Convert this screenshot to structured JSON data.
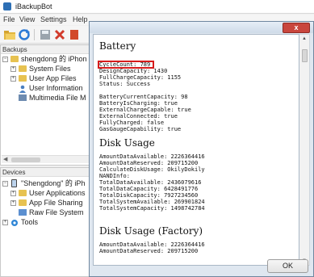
{
  "app": {
    "title": "iBackupBot",
    "menu": [
      "File",
      "View",
      "Settings",
      "Help"
    ],
    "backups_pane": {
      "header": "Backups",
      "items": [
        {
          "label": "shengdong 的 iPhon",
          "expander": "−",
          "icon": "folder"
        },
        {
          "label": "System Files",
          "expander": "+",
          "icon": "folder"
        },
        {
          "label": "User App Files",
          "expander": "+",
          "icon": "folder"
        },
        {
          "label": "User Information",
          "expander": "",
          "icon": "user"
        },
        {
          "label": "Multimedia File M",
          "expander": "",
          "icon": "media"
        }
      ]
    },
    "devices_pane": {
      "header": "Devices",
      "items": [
        {
          "label": "\"Shengdong\" 的 iPh",
          "expander": "−",
          "icon": "phone"
        },
        {
          "label": "User Applications",
          "expander": "+",
          "icon": "folder"
        },
        {
          "label": "App File Sharing",
          "expander": "+",
          "icon": "folder"
        },
        {
          "label": "Raw File System",
          "expander": "",
          "icon": "raw"
        },
        {
          "label": "Tools",
          "expander": "+",
          "icon": "tools"
        }
      ]
    }
  },
  "dialog": {
    "close_label": "x",
    "ok_label": "OK",
    "sections": [
      {
        "title": "Battery",
        "lines": "CycleCount: 789\nDesignCapacity: 1430\nFullChargeCapacity: 1155\nStatus: Success\n\nBatteryCurrentCapacity: 98\nBatteryIsCharging: true\nExternalChargeCapable: true\nExternalConnected: true\nFullyCharged: false\nGasGaugeCapability: true"
      },
      {
        "title": "Disk Usage",
        "lines": "AmountDataAvailable: 2226364416\nAmountDataReserved: 209715200\nCalculateDiskUsage: OkilyDokily\nNANDInfo:\nTotalDataAvailable: 2436079616\nTotalDataCapacity: 6428491776\nTotalDiskCapacity: 7927234560\nTotalSystemAvailable: 269901824\nTotalSystemCapacity: 1498742784"
      },
      {
        "title": "Disk Usage (Factory)",
        "lines": "AmountDataAvailable: 2226364416\nAmountDataReserved: 209715200"
      }
    ]
  },
  "colors": {
    "highlight": "#d71c1c",
    "close_button": "#c9463d",
    "dialog_frame": "#dfe7f0"
  }
}
